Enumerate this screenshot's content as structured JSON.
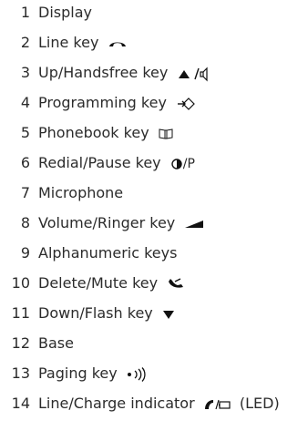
{
  "items": [
    {
      "number": "1",
      "label": "Display"
    },
    {
      "number": "2",
      "label": "Line key",
      "icon": "handset-icon"
    },
    {
      "number": "3",
      "label": "Up/Handsfree key",
      "icon": "up-arrow-speaker-icon"
    },
    {
      "number": "4",
      "label": "Programming key",
      "icon": "programming-icon"
    },
    {
      "number": "5",
      "label": "Phonebook key",
      "icon": "book-icon"
    },
    {
      "number": "6",
      "label": "Redial/Pause key",
      "icon": "redial-pause-icon",
      "icon_suffix": "/P"
    },
    {
      "number": "7",
      "label": "Microphone"
    },
    {
      "number": "8",
      "label": "Volume/Ringer key",
      "icon": "volume-wedge-icon"
    },
    {
      "number": "9",
      "label": "Alphanumeric keys"
    },
    {
      "number": "10",
      "label": "Delete/Mute key",
      "icon": "mute-icon"
    },
    {
      "number": "11",
      "label": "Down/Flash key",
      "icon": "down-arrow-icon"
    },
    {
      "number": "12",
      "label": "Base"
    },
    {
      "number": "13",
      "label": "Paging key",
      "icon": "paging-icon"
    },
    {
      "number": "14",
      "label": "Line/Charge indicator",
      "icon": "line-charge-icon",
      "icon_suffix": "(LED)"
    }
  ]
}
